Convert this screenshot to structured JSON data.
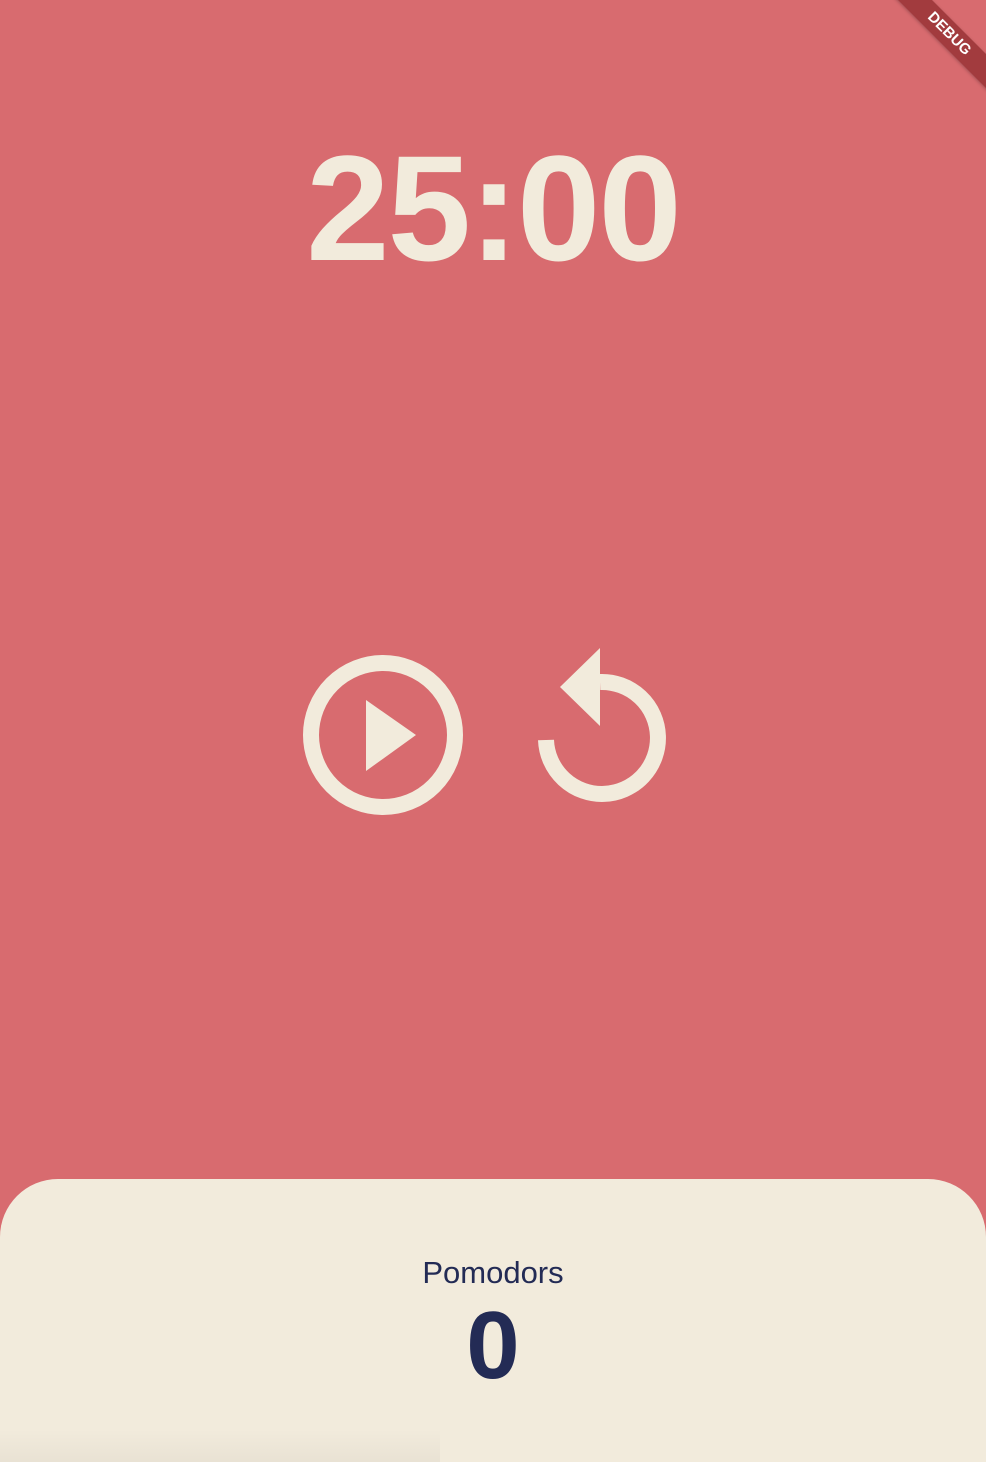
{
  "timer": {
    "display": "25:00"
  },
  "controls": {
    "play_icon": "play-circle-outline-icon",
    "restart_icon": "restart-icon"
  },
  "stats": {
    "label": "Pomodors",
    "count": "0"
  },
  "debug_banner": {
    "label": "DEBUG"
  },
  "colors": {
    "background": "#D86B6F",
    "foreground": "#F2EBDC",
    "panel": "#F2EBDC",
    "panel_text": "#232B55",
    "debug_ribbon": "#A23B3E"
  }
}
